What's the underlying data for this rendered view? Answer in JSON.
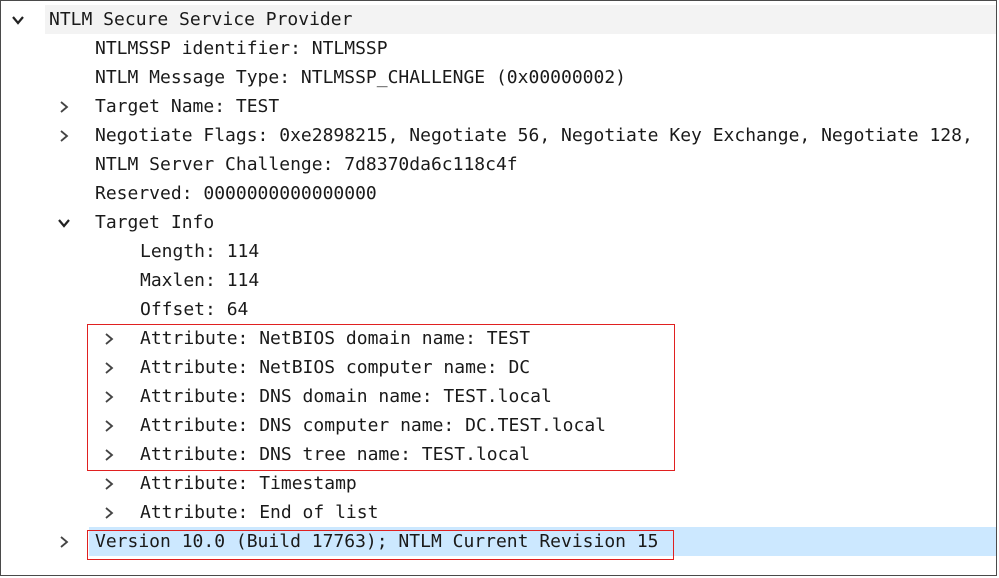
{
  "tree": {
    "root": {
      "label": "NTLM Secure Service Provider",
      "expanded": true
    },
    "ntlmssp_identifier": {
      "label": "NTLMSSP identifier: NTLMSSP"
    },
    "message_type": {
      "label": "NTLM Message Type: NTLMSSP_CHALLENGE (0x00000002)"
    },
    "target_name": {
      "label": "Target Name: TEST",
      "expanded": false
    },
    "negotiate_flags": {
      "label": "Negotiate Flags: 0xe2898215, Negotiate 56, Negotiate Key Exchange, Negotiate 128,",
      "expanded": false
    },
    "server_challenge": {
      "label": "NTLM Server Challenge: 7d8370da6c118c4f"
    },
    "reserved": {
      "label": "Reserved: 0000000000000000"
    },
    "target_info": {
      "label": "Target Info",
      "expanded": true,
      "length": "Length: 114",
      "maxlen": "Maxlen: 114",
      "offset": "Offset: 64",
      "attributes": [
        "Attribute: NetBIOS domain name: TEST",
        "Attribute: NetBIOS computer name: DC",
        "Attribute: DNS domain name: TEST.local",
        "Attribute: DNS computer name: DC.TEST.local",
        "Attribute: DNS tree name: TEST.local",
        "Attribute: Timestamp",
        "Attribute: End of list"
      ]
    },
    "version": {
      "label": "Version 10.0 (Build 17763); NTLM Current Revision 15",
      "expanded": false,
      "selected": true
    }
  },
  "colors": {
    "selection": "#cce8ff",
    "annotation_box": "#e02020",
    "root_row": "#f3f3f3"
  },
  "icons": {
    "expanded": "chevron-down-icon",
    "collapsed": "chevron-right-icon"
  }
}
